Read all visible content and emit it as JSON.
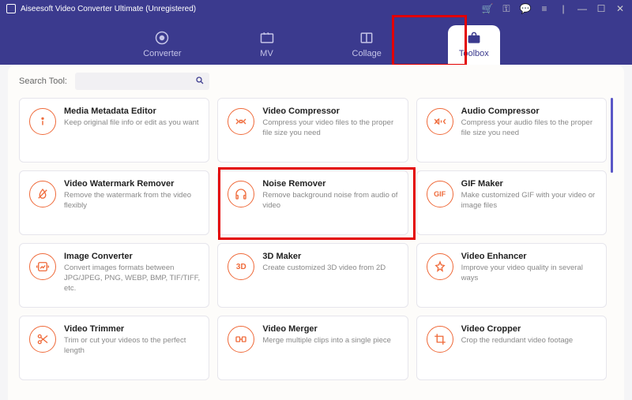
{
  "titlebar": {
    "title": "Aiseesoft Video Converter Ultimate (Unregistered)"
  },
  "nav": {
    "converter": "Converter",
    "mv": "MV",
    "collage": "Collage",
    "toolbox": "Toolbox"
  },
  "search": {
    "label": "Search Tool:",
    "placeholder": ""
  },
  "tools": [
    {
      "id": "metadata",
      "title": "Media Metadata Editor",
      "desc": "Keep original file info or edit as you want"
    },
    {
      "id": "vcompress",
      "title": "Video Compressor",
      "desc": "Compress your video files to the proper file size you need"
    },
    {
      "id": "acompress",
      "title": "Audio Compressor",
      "desc": "Compress your audio files to the proper file size you need"
    },
    {
      "id": "watermark",
      "title": "Video Watermark Remover",
      "desc": "Remove the watermark from the video flexibly"
    },
    {
      "id": "noise",
      "title": "Noise Remover",
      "desc": "Remove background noise from audio of video"
    },
    {
      "id": "gif",
      "title": "GIF Maker",
      "desc": "Make customized GIF with your video or image files"
    },
    {
      "id": "imgconv",
      "title": "Image Converter",
      "desc": "Convert images formats between JPG/JPEG, PNG, WEBP, BMP, TIF/TIFF, etc."
    },
    {
      "id": "3d",
      "title": "3D Maker",
      "desc": "Create customized 3D video from 2D"
    },
    {
      "id": "enhance",
      "title": "Video Enhancer",
      "desc": "Improve your video quality in several ways"
    },
    {
      "id": "trim",
      "title": "Video Trimmer",
      "desc": "Trim or cut your videos to the perfect length"
    },
    {
      "id": "merge",
      "title": "Video Merger",
      "desc": "Merge multiple clips into a single piece"
    },
    {
      "id": "crop",
      "title": "Video Cropper",
      "desc": "Crop the redundant video footage"
    }
  ],
  "iconText": {
    "gif": "GIF",
    "threeD": "3D"
  }
}
